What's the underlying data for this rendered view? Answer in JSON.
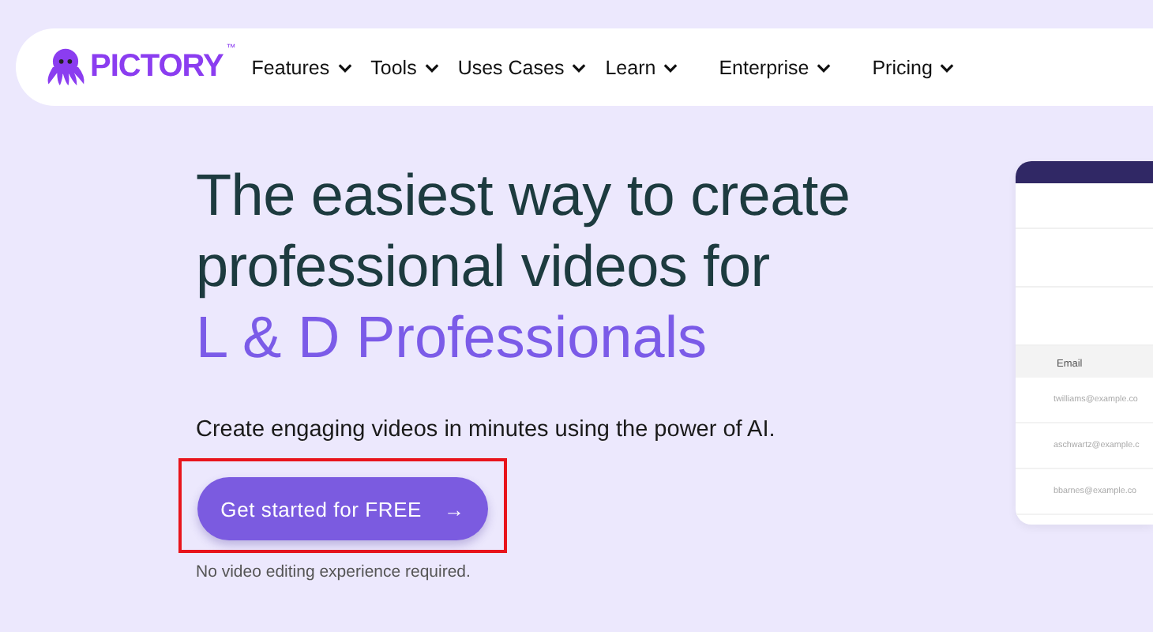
{
  "brand": {
    "name": "PICTORY",
    "mark": "™"
  },
  "nav": [
    {
      "label": "Features"
    },
    {
      "label": "Tools"
    },
    {
      "label": "Uses Cases"
    },
    {
      "label": "Learn"
    },
    {
      "label": "Enterprise"
    },
    {
      "label": "Pricing"
    }
  ],
  "hero": {
    "headline": [
      "The easiest way to create",
      "professional videos for"
    ],
    "highlight": "L & D Professionals",
    "subtitle": "Create engaging videos in minutes using the power of AI.",
    "cta": {
      "label": "Get started for FREE",
      "icon": "→",
      "highlighted": true
    },
    "note": "No video editing experience required."
  },
  "preview_table": {
    "column": "Email",
    "rows": [
      "twilliams@example.co",
      "aschwartz@example.c",
      "bbarnes@example.co"
    ]
  }
}
